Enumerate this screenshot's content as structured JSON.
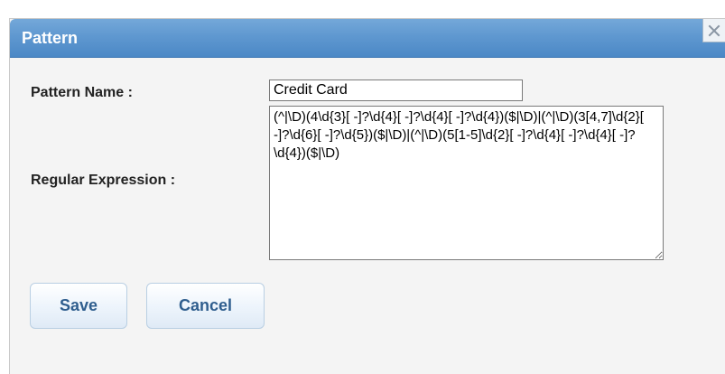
{
  "dialog": {
    "title": "Pattern",
    "close_icon": "close-icon"
  },
  "form": {
    "name_label": "Pattern Name :",
    "name_value": "Credit Card",
    "regex_label": "Regular Expression :",
    "regex_value": "(^|\\D)(4\\d{3}[ -]?\\d{4}[ -]?\\d{4}[ -]?\\d{4})($|\\D)|(^|\\D)(3[4,7]\\d{2}[ -]?\\d{6}[ -]?\\d{5})($|\\D)|(^|\\D)(5[1-5]\\d{2}[ -]?\\d{4}[ -]?\\d{4}[ -]?\\d{4})($|\\D)"
  },
  "buttons": {
    "save_label": "Save",
    "cancel_label": "Cancel"
  },
  "colors": {
    "titlebar": "#5f98d0",
    "button_text": "#2f5e8e",
    "dialog_bg": "#f4f4f4"
  }
}
